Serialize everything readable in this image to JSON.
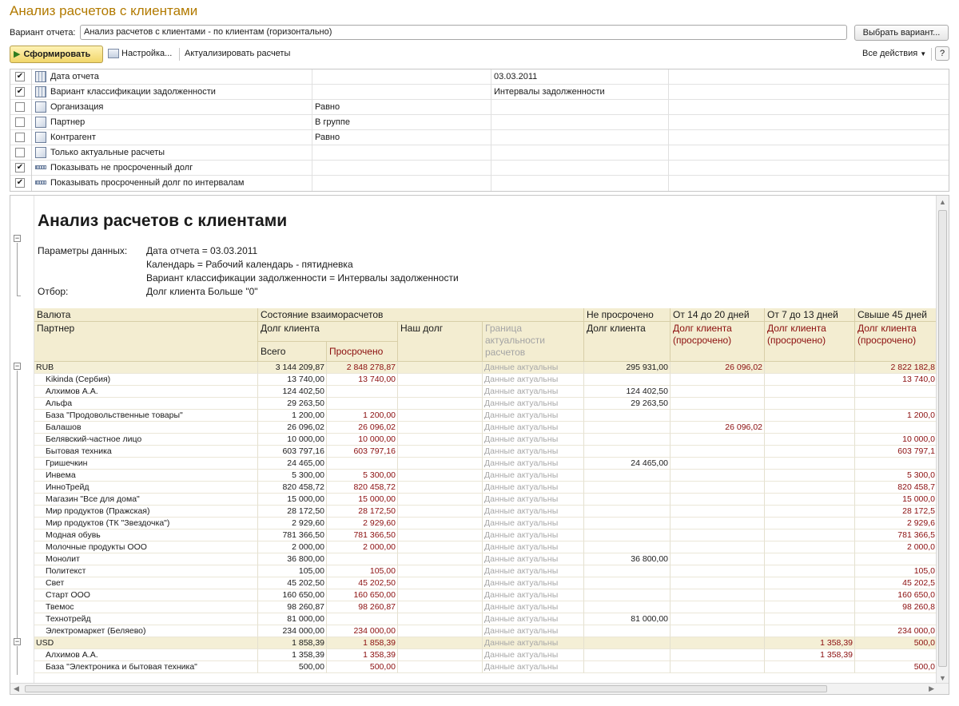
{
  "header": {
    "title": "Анализ расчетов с клиентами",
    "variant_label": "Вариант отчета:",
    "variant_value": "Анализ расчетов с клиентами - по клиентам (горизонтально)",
    "choose_variant": "Выбрать вариант..."
  },
  "toolbar": {
    "form_label": "Сформировать",
    "settings_label": "Настройка...",
    "update_label": "Актуализировать расчеты",
    "all_actions": "Все действия",
    "help": "?"
  },
  "settings": [
    {
      "checked": true,
      "icon": "calendar-icon",
      "label": "Дата отчета",
      "cmp": "",
      "value": "03.03.2011"
    },
    {
      "checked": true,
      "icon": "calendar-icon",
      "label": "Вариант классификации задолженности",
      "cmp": "",
      "value": "Интервалы задолженности"
    },
    {
      "checked": false,
      "icon": "filter-icon",
      "label": "Организация",
      "cmp": "Равно",
      "value": ""
    },
    {
      "checked": false,
      "icon": "filter-icon",
      "label": "Партнер",
      "cmp": "В группе",
      "value": ""
    },
    {
      "checked": false,
      "icon": "filter-icon",
      "label": "Контрагент",
      "cmp": "Равно",
      "value": ""
    },
    {
      "checked": false,
      "icon": "filter-icon",
      "label": "Только актуальные расчеты",
      "cmp": "",
      "value": ""
    },
    {
      "checked": true,
      "icon": "option-icon",
      "label": "Показывать не просроченный долг",
      "cmp": "",
      "value": ""
    },
    {
      "checked": true,
      "icon": "option-icon",
      "label": "Показывать просроченный долг по интервалам",
      "cmp": "",
      "value": ""
    }
  ],
  "report": {
    "title": "Анализ расчетов с клиентами",
    "params_label": "Параметры данных:",
    "params": [
      "Дата отчета = 03.03.2011",
      "Календарь = Рабочий календарь - пятидневка",
      "Вариант классификации задолженности = Интервалы задолженности"
    ],
    "filter_label": "Отбор:",
    "filter_value": "Долг клиента Больше \"0\"",
    "headers": {
      "currency": "Валюта",
      "state": "Состояние взаиморасчетов",
      "not_overdue": "Не просрочено",
      "i14_20": "От 14 до 20 дней",
      "i7_13": "От 7 до 13 дней",
      "over45": "Свыше 45 дней",
      "partner": "Партнер",
      "client_debt": "Долг клиента",
      "our_debt": "Наш долг",
      "boundary": "Граница актуальности расчетов",
      "total": "Всего",
      "overdue": "Просрочено",
      "client_debt_overdue": "Долг клиента (просрочено)"
    },
    "rows": [
      {
        "group": true,
        "name": "RUB",
        "total": "3 144 209,87",
        "overdue": "2 848 278,87",
        "our": "",
        "status": "Данные актуальны",
        "not_overdue": "295 931,00",
        "i14": "26 096,02",
        "i7": "",
        "i45": "2 822 182,8"
      },
      {
        "group": false,
        "name": "Kikinda (Сербия)",
        "total": "13 740,00",
        "overdue": "13 740,00",
        "our": "",
        "status": "Данные актуальны",
        "not_overdue": "",
        "i14": "",
        "i7": "",
        "i45": "13 740,0"
      },
      {
        "group": false,
        "name": "Алхимов А.А.",
        "total": "124 402,50",
        "overdue": "",
        "our": "",
        "status": "Данные актуальны",
        "not_overdue": "124 402,50",
        "i14": "",
        "i7": "",
        "i45": ""
      },
      {
        "group": false,
        "name": "Альфа",
        "total": "29 263,50",
        "overdue": "",
        "our": "",
        "status": "Данные актуальны",
        "not_overdue": "29 263,50",
        "i14": "",
        "i7": "",
        "i45": ""
      },
      {
        "group": false,
        "name": "База \"Продовольственные товары\"",
        "total": "1 200,00",
        "overdue": "1 200,00",
        "our": "",
        "status": "Данные актуальны",
        "not_overdue": "",
        "i14": "",
        "i7": "",
        "i45": "1 200,0"
      },
      {
        "group": false,
        "name": "Балашов",
        "total": "26 096,02",
        "overdue": "26 096,02",
        "our": "",
        "status": "Данные актуальны",
        "not_overdue": "",
        "i14": "26 096,02",
        "i7": "",
        "i45": ""
      },
      {
        "group": false,
        "name": "Белявский-частное лицо",
        "total": "10 000,00",
        "overdue": "10 000,00",
        "our": "",
        "status": "Данные актуальны",
        "not_overdue": "",
        "i14": "",
        "i7": "",
        "i45": "10 000,0"
      },
      {
        "group": false,
        "name": "Бытовая техника",
        "total": "603 797,16",
        "overdue": "603 797,16",
        "our": "",
        "status": "Данные актуальны",
        "not_overdue": "",
        "i14": "",
        "i7": "",
        "i45": "603 797,1"
      },
      {
        "group": false,
        "name": "Гришечкин",
        "total": "24 465,00",
        "overdue": "",
        "our": "",
        "status": "Данные актуальны",
        "not_overdue": "24 465,00",
        "i14": "",
        "i7": "",
        "i45": ""
      },
      {
        "group": false,
        "name": "Инвема",
        "total": "5 300,00",
        "overdue": "5 300,00",
        "our": "",
        "status": "Данные актуальны",
        "not_overdue": "",
        "i14": "",
        "i7": "",
        "i45": "5 300,0"
      },
      {
        "group": false,
        "name": "ИнноТрейд",
        "total": "820 458,72",
        "overdue": "820 458,72",
        "our": "",
        "status": "Данные актуальны",
        "not_overdue": "",
        "i14": "",
        "i7": "",
        "i45": "820 458,7"
      },
      {
        "group": false,
        "name": "Магазин \"Все для дома\"",
        "total": "15 000,00",
        "overdue": "15 000,00",
        "our": "",
        "status": "Данные актуальны",
        "not_overdue": "",
        "i14": "",
        "i7": "",
        "i45": "15 000,0"
      },
      {
        "group": false,
        "name": "Мир продуктов (Пражская)",
        "total": "28 172,50",
        "overdue": "28 172,50",
        "our": "",
        "status": "Данные актуальны",
        "not_overdue": "",
        "i14": "",
        "i7": "",
        "i45": "28 172,5"
      },
      {
        "group": false,
        "name": "Мир продуктов (ТК \"Звездочка\")",
        "total": "2 929,60",
        "overdue": "2 929,60",
        "our": "",
        "status": "Данные актуальны",
        "not_overdue": "",
        "i14": "",
        "i7": "",
        "i45": "2 929,6"
      },
      {
        "group": false,
        "name": "Модная обувь",
        "total": "781 366,50",
        "overdue": "781 366,50",
        "our": "",
        "status": "Данные актуальны",
        "not_overdue": "",
        "i14": "",
        "i7": "",
        "i45": "781 366,5"
      },
      {
        "group": false,
        "name": "Молочные продукты ООО",
        "total": "2 000,00",
        "overdue": "2 000,00",
        "our": "",
        "status": "Данные актуальны",
        "not_overdue": "",
        "i14": "",
        "i7": "",
        "i45": "2 000,0"
      },
      {
        "group": false,
        "name": "Монолит",
        "total": "36 800,00",
        "overdue": "",
        "our": "",
        "status": "Данные актуальны",
        "not_overdue": "36 800,00",
        "i14": "",
        "i7": "",
        "i45": ""
      },
      {
        "group": false,
        "name": "Политекст",
        "total": "105,00",
        "overdue": "105,00",
        "our": "",
        "status": "Данные актуальны",
        "not_overdue": "",
        "i14": "",
        "i7": "",
        "i45": "105,0"
      },
      {
        "group": false,
        "name": "Свет",
        "total": "45 202,50",
        "overdue": "45 202,50",
        "our": "",
        "status": "Данные актуальны",
        "not_overdue": "",
        "i14": "",
        "i7": "",
        "i45": "45 202,5"
      },
      {
        "group": false,
        "name": "Старт ООО",
        "total": "160 650,00",
        "overdue": "160 650,00",
        "our": "",
        "status": "Данные актуальны",
        "not_overdue": "",
        "i14": "",
        "i7": "",
        "i45": "160 650,0"
      },
      {
        "group": false,
        "name": "Твемос",
        "total": "98 260,87",
        "overdue": "98 260,87",
        "our": "",
        "status": "Данные актуальны",
        "not_overdue": "",
        "i14": "",
        "i7": "",
        "i45": "98 260,8"
      },
      {
        "group": false,
        "name": "Технотрейд",
        "total": "81 000,00",
        "overdue": "",
        "our": "",
        "status": "Данные актуальны",
        "not_overdue": "81 000,00",
        "i14": "",
        "i7": "",
        "i45": ""
      },
      {
        "group": false,
        "name": "Электромаркет (Беляево)",
        "total": "234 000,00",
        "overdue": "234 000,00",
        "our": "",
        "status": "Данные актуальны",
        "not_overdue": "",
        "i14": "",
        "i7": "",
        "i45": "234 000,0"
      },
      {
        "group": true,
        "name": "USD",
        "total": "1 858,39",
        "overdue": "1 858,39",
        "our": "",
        "status": "Данные актуальны",
        "not_overdue": "",
        "i14": "",
        "i7": "1 358,39",
        "i45": "500,0"
      },
      {
        "group": false,
        "name": "Алхимов А.А.",
        "total": "1 358,39",
        "overdue": "1 358,39",
        "our": "",
        "status": "Данные актуальны",
        "not_overdue": "",
        "i14": "",
        "i7": "1 358,39",
        "i45": ""
      },
      {
        "group": false,
        "name": "База \"Электроника и бытовая техника\"",
        "total": "500,00",
        "overdue": "500,00",
        "our": "",
        "status": "Данные актуальны",
        "not_overdue": "",
        "i14": "",
        "i7": "",
        "i45": "500,0"
      }
    ]
  }
}
